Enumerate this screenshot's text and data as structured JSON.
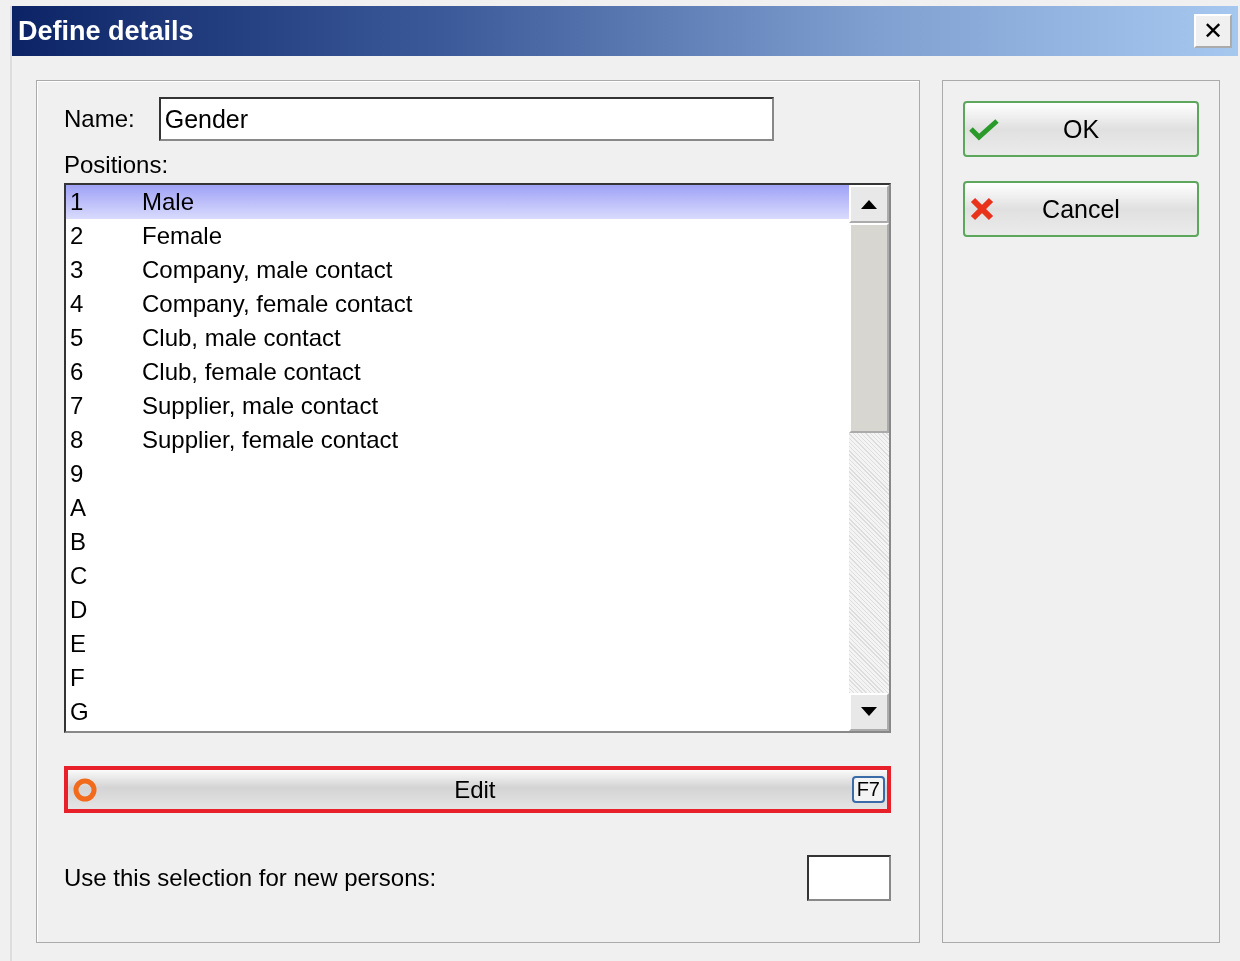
{
  "window": {
    "title": "Define details",
    "close": "✕"
  },
  "name_field": {
    "label": "Name:",
    "value": "Gender"
  },
  "positions": {
    "label": "Positions:",
    "rows": [
      {
        "code": "1",
        "text": "Male",
        "selected": true
      },
      {
        "code": "2",
        "text": "Female",
        "selected": false
      },
      {
        "code": "3",
        "text": "Company, male contact",
        "selected": false
      },
      {
        "code": "4",
        "text": "Company, female contact",
        "selected": false
      },
      {
        "code": "5",
        "text": "Club, male contact",
        "selected": false
      },
      {
        "code": "6",
        "text": "Club, female contact",
        "selected": false
      },
      {
        "code": "7",
        "text": "Supplier, male contact",
        "selected": false
      },
      {
        "code": "8",
        "text": "Supplier, female contact",
        "selected": false
      },
      {
        "code": "9",
        "selected": false
      },
      {
        "code": "A",
        "selected": false
      },
      {
        "code": "B",
        "selected": false
      },
      {
        "code": "C",
        "selected": false
      },
      {
        "code": "D",
        "selected": false
      },
      {
        "code": "E",
        "selected": false
      },
      {
        "code": "F",
        "selected": false
      },
      {
        "code": "G",
        "selected": false
      }
    ]
  },
  "edit_button": {
    "label": "Edit",
    "shortcut": "F7",
    "highlighted": true
  },
  "new_persons": {
    "label": "Use this selection for new persons:"
  },
  "buttons": [
    {
      "kind": "ok",
      "label": "OK"
    },
    {
      "kind": "cancel",
      "label": "Cancel"
    }
  ]
}
